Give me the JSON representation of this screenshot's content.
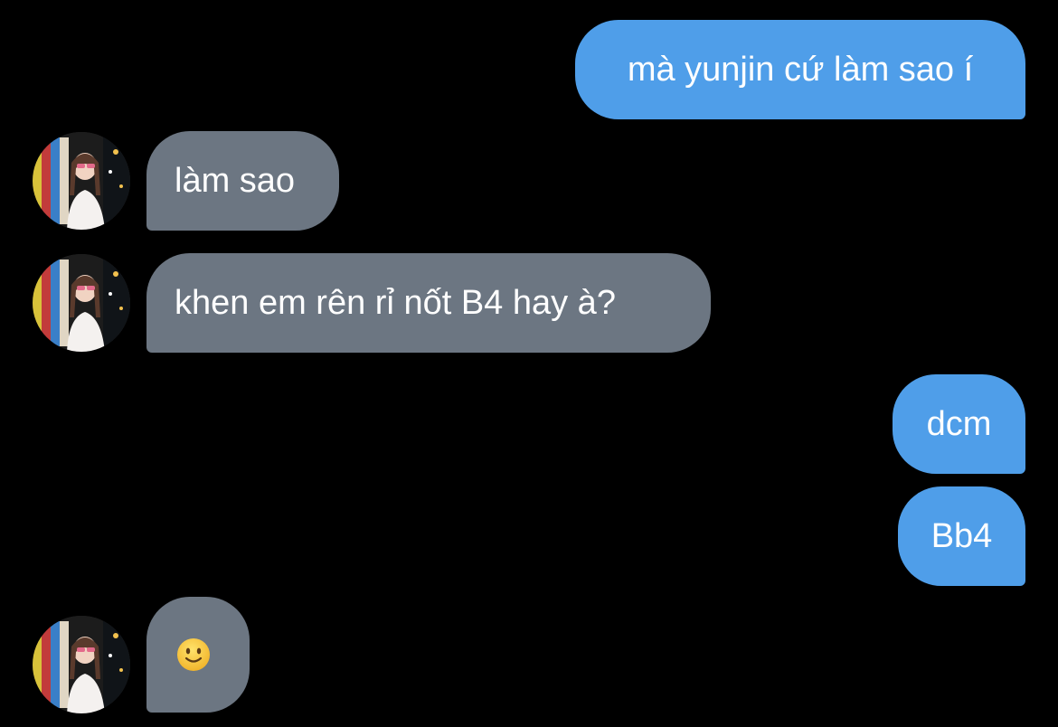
{
  "messages": [
    {
      "id": "m1",
      "direction": "outgoing",
      "text": "mà yunjin cứ làm sao í",
      "has_avatar": false
    },
    {
      "id": "m2",
      "direction": "incoming",
      "text": "làm sao",
      "has_avatar": true
    },
    {
      "id": "m3",
      "direction": "incoming",
      "text": "khen em rên rỉ nốt B4 hay à?",
      "has_avatar": true
    },
    {
      "id": "m4",
      "direction": "outgoing",
      "text": "dcm",
      "has_avatar": false
    },
    {
      "id": "m5",
      "direction": "outgoing",
      "text": "Bb4",
      "has_avatar": false
    },
    {
      "id": "m6",
      "direction": "incoming",
      "text": "",
      "emoji": "slightly-smiling-face-icon",
      "has_avatar": true
    }
  ],
  "colors": {
    "background": "#000000",
    "outgoing_bubble": "#4f9ee9",
    "incoming_bubble": "#6c7682",
    "text": "#ffffff"
  }
}
